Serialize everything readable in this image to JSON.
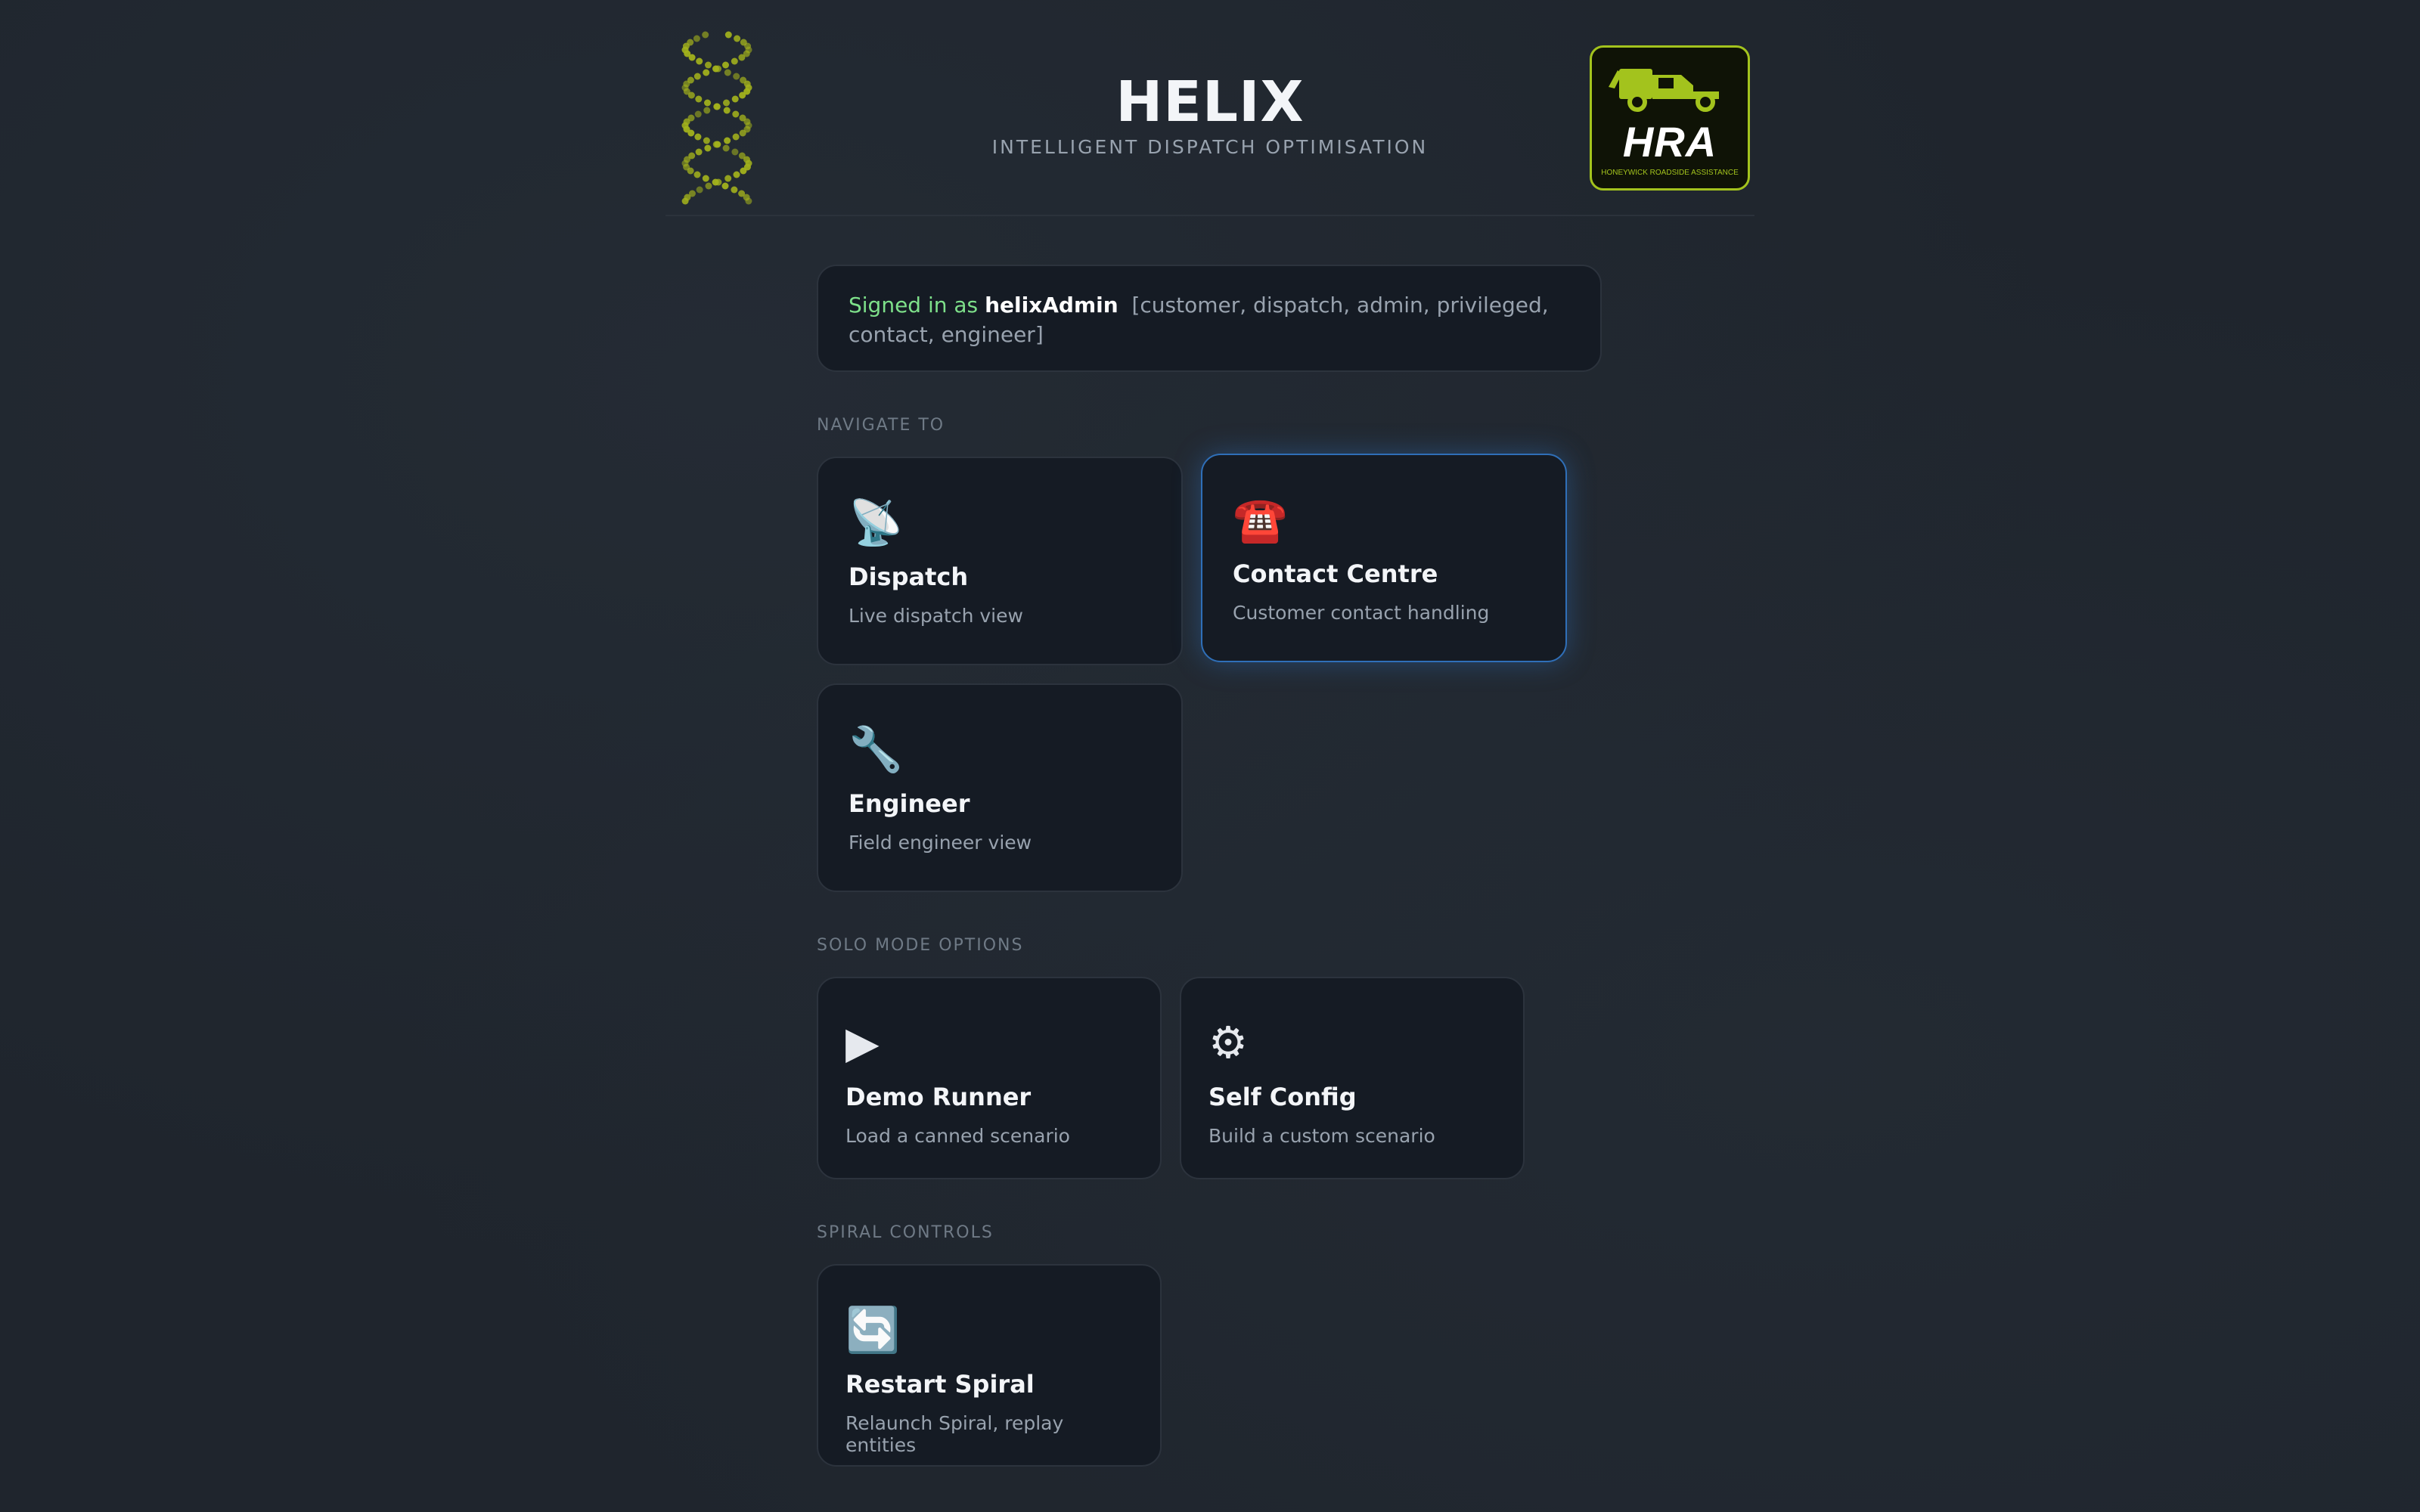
{
  "header": {
    "title": "HELIX",
    "subtitle": "INTELLIGENT DISPATCH OPTIMISATION",
    "logo": {
      "text": "HRA",
      "subtext": "HONEYWICK ROADSIDE ASSISTANCE",
      "accent_color": "#a3c31d"
    }
  },
  "session": {
    "prefix": "Signed in as",
    "username": "helixAdmin",
    "roles": "[customer, dispatch, admin, privileged, contact, engineer]"
  },
  "sections": {
    "navigate": {
      "label": "NAVIGATE TO",
      "cards": [
        {
          "icon": "📡",
          "icon_name": "satellite-dish-icon",
          "title": "Dispatch",
          "desc": "Live dispatch view"
        },
        {
          "icon": "☎️",
          "icon_name": "telephone-icon",
          "title": "Contact Centre",
          "desc": "Customer contact handling"
        },
        {
          "icon": "🔧",
          "icon_name": "wrench-icon",
          "title": "Engineer",
          "desc": "Field engineer view"
        }
      ]
    },
    "solo": {
      "label": "SOLO MODE OPTIONS",
      "cards": [
        {
          "icon": "▶",
          "icon_name": "play-icon",
          "title": "Demo Runner",
          "desc": "Load a canned scenario"
        },
        {
          "icon": "⚙",
          "icon_name": "gear-icon",
          "title": "Self Config",
          "desc": "Build a custom scenario"
        }
      ]
    },
    "spiral": {
      "label": "SPIRAL CONTROLS",
      "cards": [
        {
          "icon": "🔄",
          "icon_name": "restart-icon",
          "title": "Restart Spiral",
          "desc": "Relaunch Spiral, replay entities"
        }
      ]
    }
  },
  "colors": {
    "background": "#1f252d",
    "card": "#151b24",
    "highlight_border": "#2f6fb8",
    "signed_green": "#7ee08a"
  }
}
